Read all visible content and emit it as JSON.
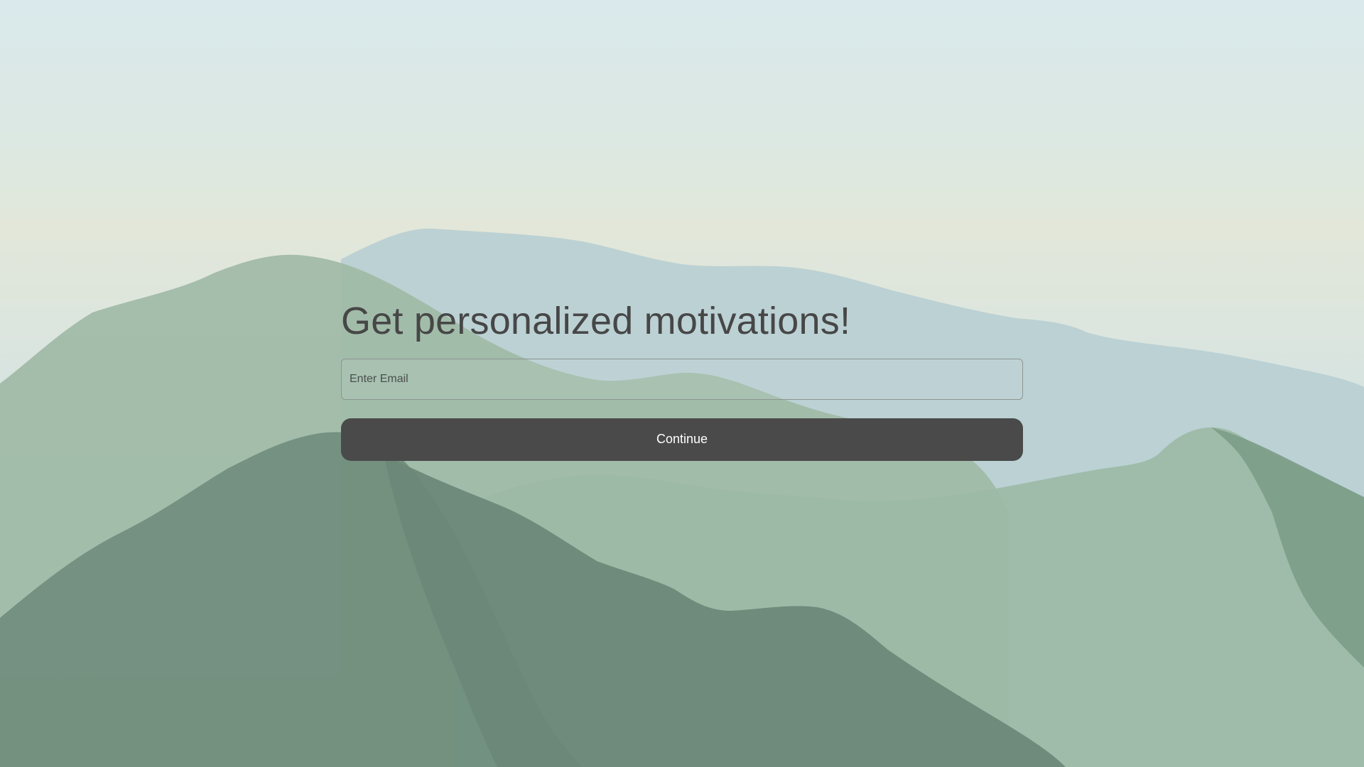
{
  "background": {
    "sky_color": "#dce8e6",
    "far_ridge_color": "#b8cfd2",
    "mid_ridge_color": "#9db8a4",
    "near_ridge_color": "#6e8a7a",
    "accent_ridge_color": "#7ea08a"
  },
  "signup": {
    "headline": "Get personalized motivations!",
    "email_placeholder": "Enter Email",
    "email_value": "",
    "continue_label": "Continue",
    "button_color": "#4a4a4a"
  }
}
